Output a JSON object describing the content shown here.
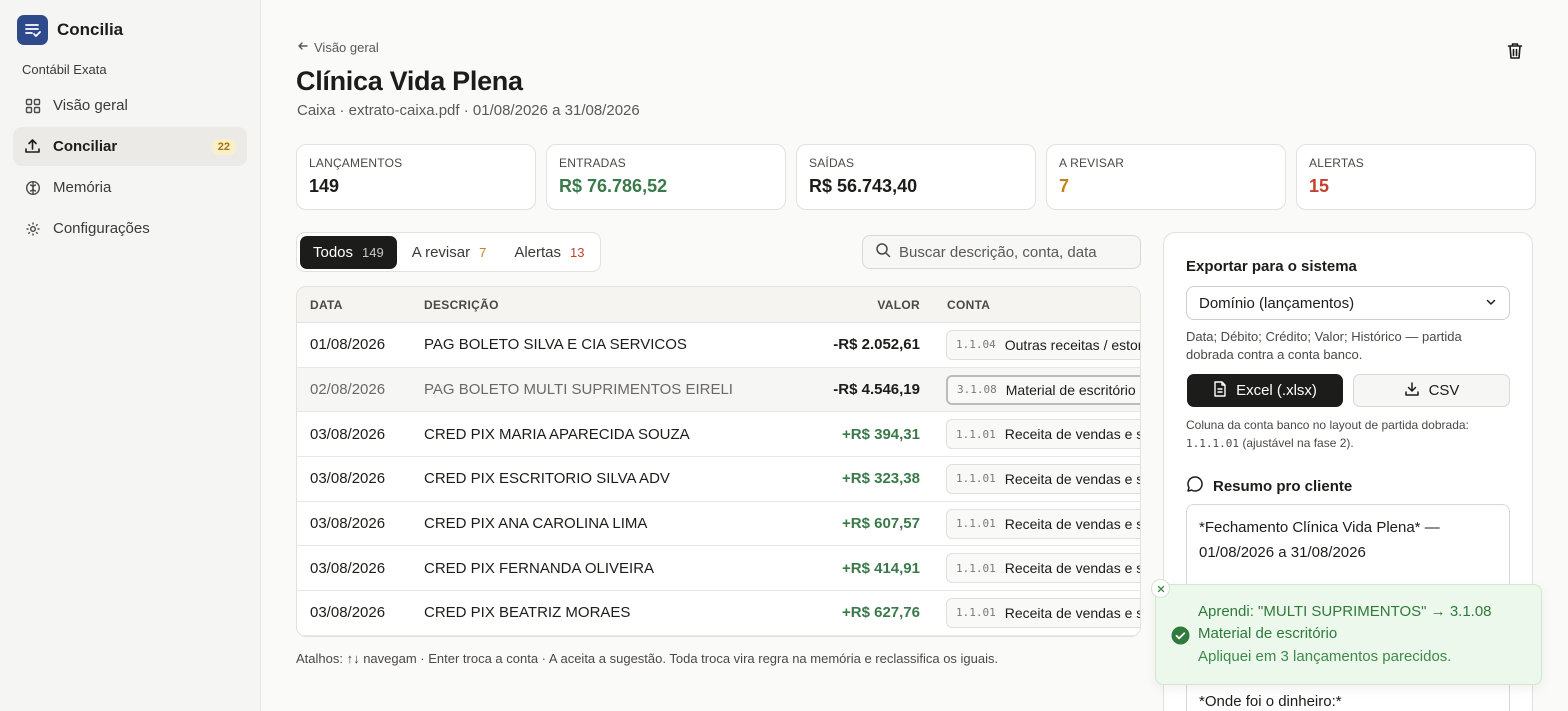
{
  "sidebar": {
    "brand": "Concilia",
    "org": "Contábil Exata",
    "items": [
      {
        "label": "Visão geral",
        "icon": "grid-icon"
      },
      {
        "label": "Conciliar",
        "icon": "upload-icon",
        "badge": "22",
        "active": true
      },
      {
        "label": "Memória",
        "icon": "brain-icon"
      },
      {
        "label": "Configurações",
        "icon": "gear-icon"
      }
    ]
  },
  "header": {
    "back": "Visão geral",
    "title": "Clínica Vida Plena",
    "subtitle": "Caixa · extrato-caixa.pdf · 01/08/2026 a 31/08/2026"
  },
  "stats": [
    {
      "label": "LANÇAMENTOS",
      "value": "149",
      "color": "#1c1c1a"
    },
    {
      "label": "ENTRADAS",
      "value": "R$ 76.786,52",
      "color": "#3a7a4a"
    },
    {
      "label": "SAÍDAS",
      "value": "R$ 56.743,40",
      "color": "#1c1c1a"
    },
    {
      "label": "A REVISAR",
      "value": "7",
      "color": "#c7811a"
    },
    {
      "label": "ALERTAS",
      "value": "15",
      "color": "#c2412f"
    }
  ],
  "tabs": [
    {
      "label": "Todos",
      "count": "149",
      "count_color": "#c9c8c4",
      "active": true
    },
    {
      "label": "A revisar",
      "count": "7",
      "count_color": "#c7811a"
    },
    {
      "label": "Alertas",
      "count": "13",
      "count_color": "#c2412f"
    }
  ],
  "search": {
    "placeholder": "Buscar descrição, conta, data"
  },
  "table": {
    "headers": {
      "date": "DATA",
      "desc": "DESCRIÇÃO",
      "value": "VALOR",
      "account": "CONTA"
    },
    "rows": [
      {
        "date": "01/08/2026",
        "desc": "PAG BOLETO SILVA E CIA SERVICOS",
        "value": "-R$ 2.052,61",
        "code": "1.1.04",
        "account": "Outras receitas / estornos"
      },
      {
        "date": "02/08/2026",
        "desc": "PAG BOLETO MULTI SUPRIMENTOS EIRELI",
        "value": "-R$ 4.546,19",
        "code": "3.1.08",
        "account": "Material de escritório"
      },
      {
        "date": "03/08/2026",
        "desc": "CRED PIX MARIA APARECIDA SOUZA",
        "value": "+R$ 394,31",
        "code": "1.1.01",
        "account": "Receita de vendas e serviços"
      },
      {
        "date": "03/08/2026",
        "desc": "CRED PIX ESCRITORIO SILVA ADV",
        "value": "+R$ 323,38",
        "code": "1.1.01",
        "account": "Receita de vendas e serviços"
      },
      {
        "date": "03/08/2026",
        "desc": "CRED PIX ANA CAROLINA LIMA",
        "value": "+R$ 607,57",
        "code": "1.1.01",
        "account": "Receita de vendas e serviços"
      },
      {
        "date": "03/08/2026",
        "desc": "CRED PIX FERNANDA OLIVEIRA",
        "value": "+R$ 414,91",
        "code": "1.1.01",
        "account": "Receita de vendas e serviços"
      },
      {
        "date": "03/08/2026",
        "desc": "CRED PIX BEATRIZ MORAES",
        "value": "+R$ 627,76",
        "code": "1.1.01",
        "account": "Receita de vendas e serviços"
      }
    ]
  },
  "shortcuts": "Atalhos: ↑↓ navegam · Enter troca a conta · A aceita a sugestão. Toda troca vira regra na memória e reclassifica os iguais.",
  "export": {
    "title": "Exportar para o sistema",
    "select_value": "Domínio (lançamentos)",
    "help": "Data; Débito; Crédito; Valor; Histórico — partida dobrada contra a conta banco.",
    "excel_label": "Excel (.xlsx)",
    "csv_label": "CSV",
    "note_prefix": "Coluna da conta banco no layout de partida dobrada:",
    "note_code": "1.1.1.01",
    "note_suffix": "(ajustável na fase 2).",
    "summary_title": "Resumo pro cliente",
    "summary_line1": "*Fechamento Clínica Vida Plena* — 01/08/2026 a 31/08/2026",
    "summary_line2": "*Onde foi o dinheiro:*"
  },
  "toast": {
    "title": "Aprendi: \"MULTI SUPRIMENTOS\" → 3.1.08 Material de escritório",
    "body": "Apliquei em 3 lançamentos parecidos."
  }
}
